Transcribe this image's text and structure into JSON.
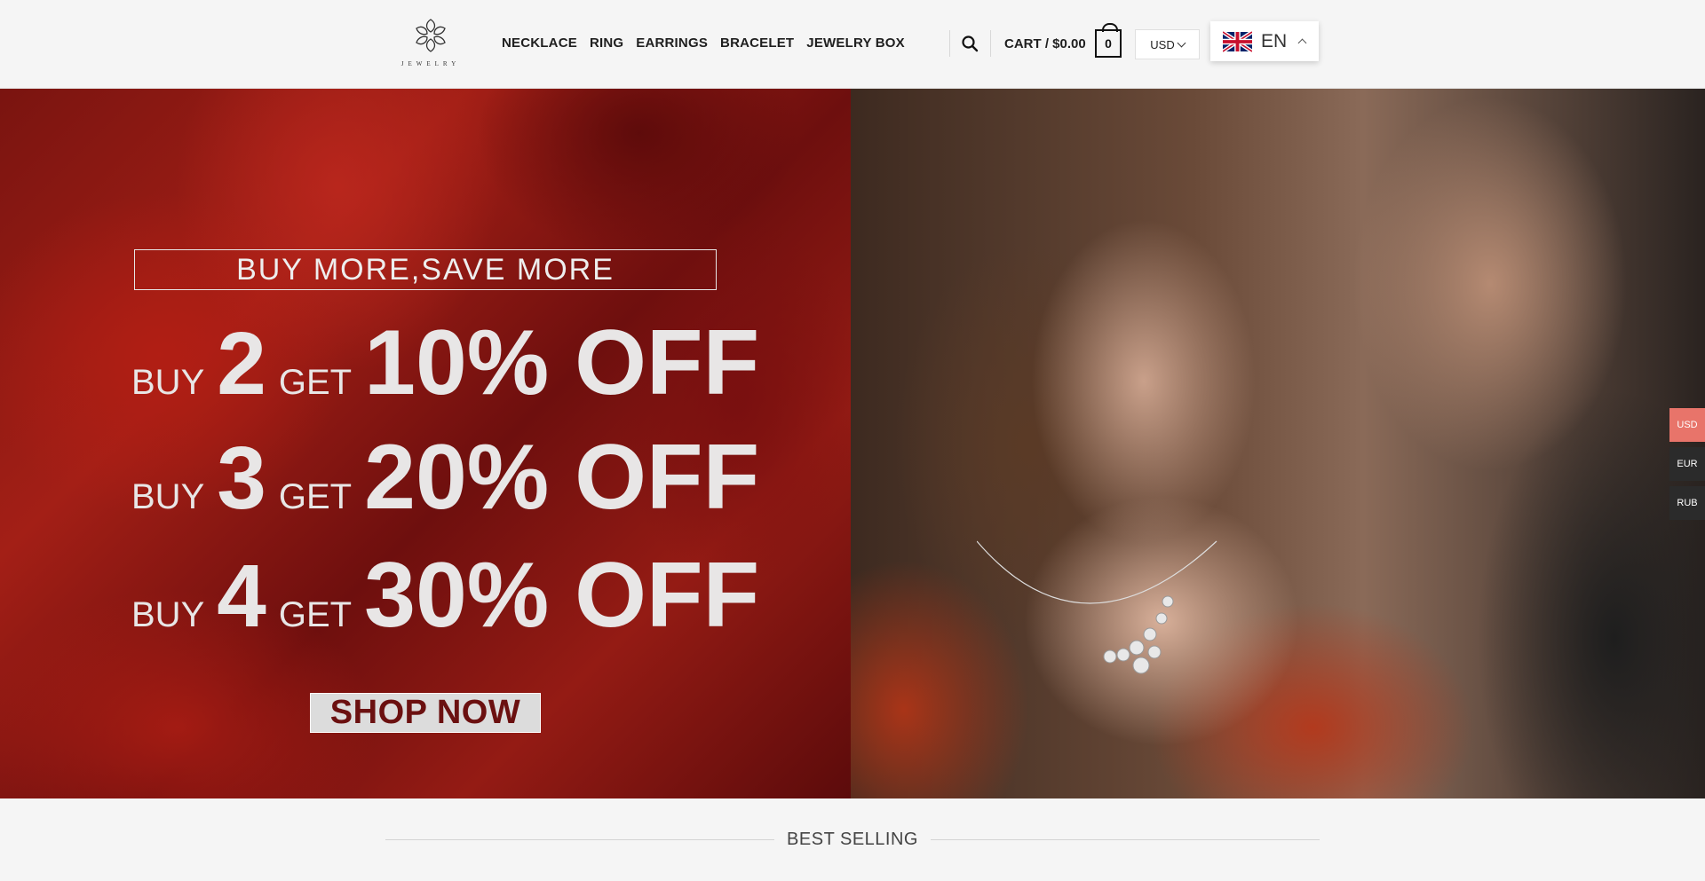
{
  "header": {
    "logo_text": "JEWELRY",
    "nav": [
      "NECKLACE",
      "RING",
      "EARRINGS",
      "BRACELET",
      "JEWELRY BOX"
    ],
    "cart_label": "CART / $0.00",
    "cart_count": "0",
    "currency": "USD",
    "language": "EN"
  },
  "hero": {
    "promo_title": "BUY MORE,SAVE MORE",
    "offers": [
      {
        "buy": "BUY",
        "qty": "2",
        "get": "GET",
        "discount": "10% OFF"
      },
      {
        "buy": "BUY",
        "qty": "3",
        "get": "GET",
        "discount": "20% OFF"
      },
      {
        "buy": "BUY",
        "qty": "4",
        "get": "GET",
        "discount": "30% OFF"
      }
    ],
    "cta": "SHOP NOW"
  },
  "side_currency": {
    "options": [
      "USD",
      "EUR",
      "RUB"
    ],
    "active_color": "#e8746a"
  },
  "sections": {
    "best_selling": "BEST SELLING"
  }
}
